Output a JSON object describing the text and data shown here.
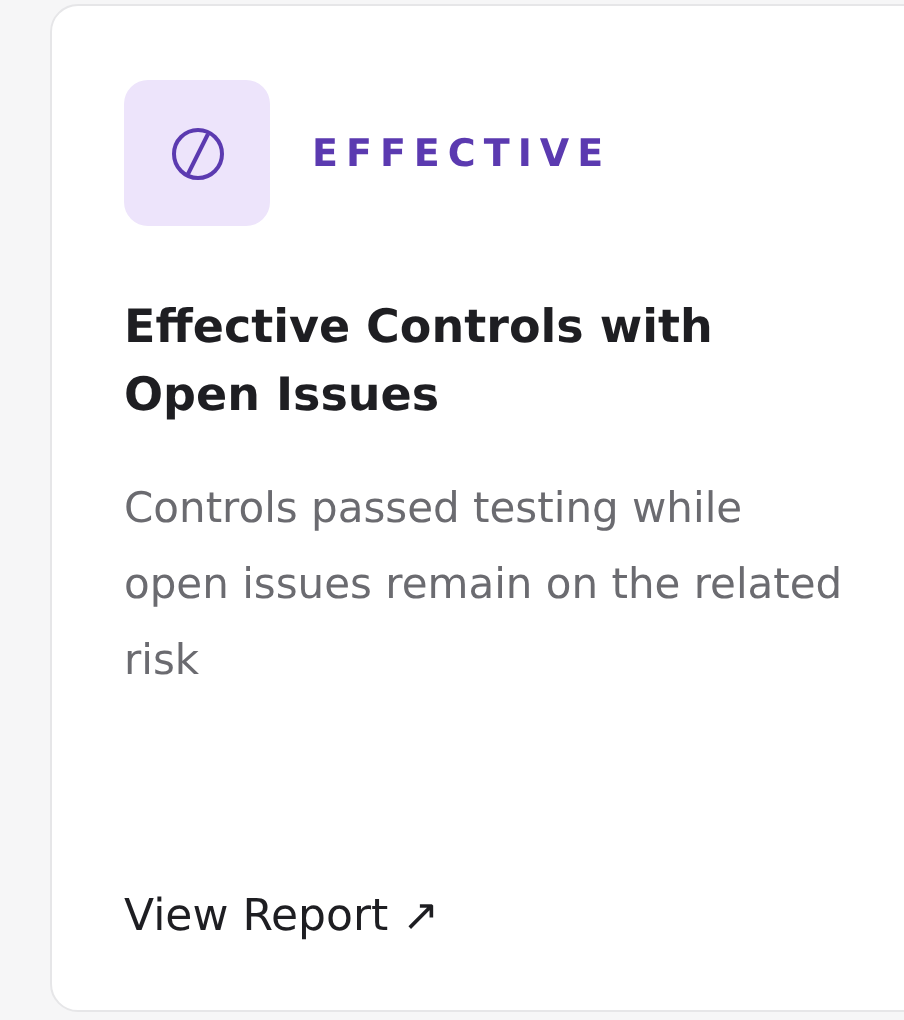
{
  "card": {
    "category": "EFFECTIVE",
    "title": "Effective Controls with Open Issues",
    "description": "Controls passed testing while open issues remain on the related risk",
    "link": "View Report ↗"
  }
}
